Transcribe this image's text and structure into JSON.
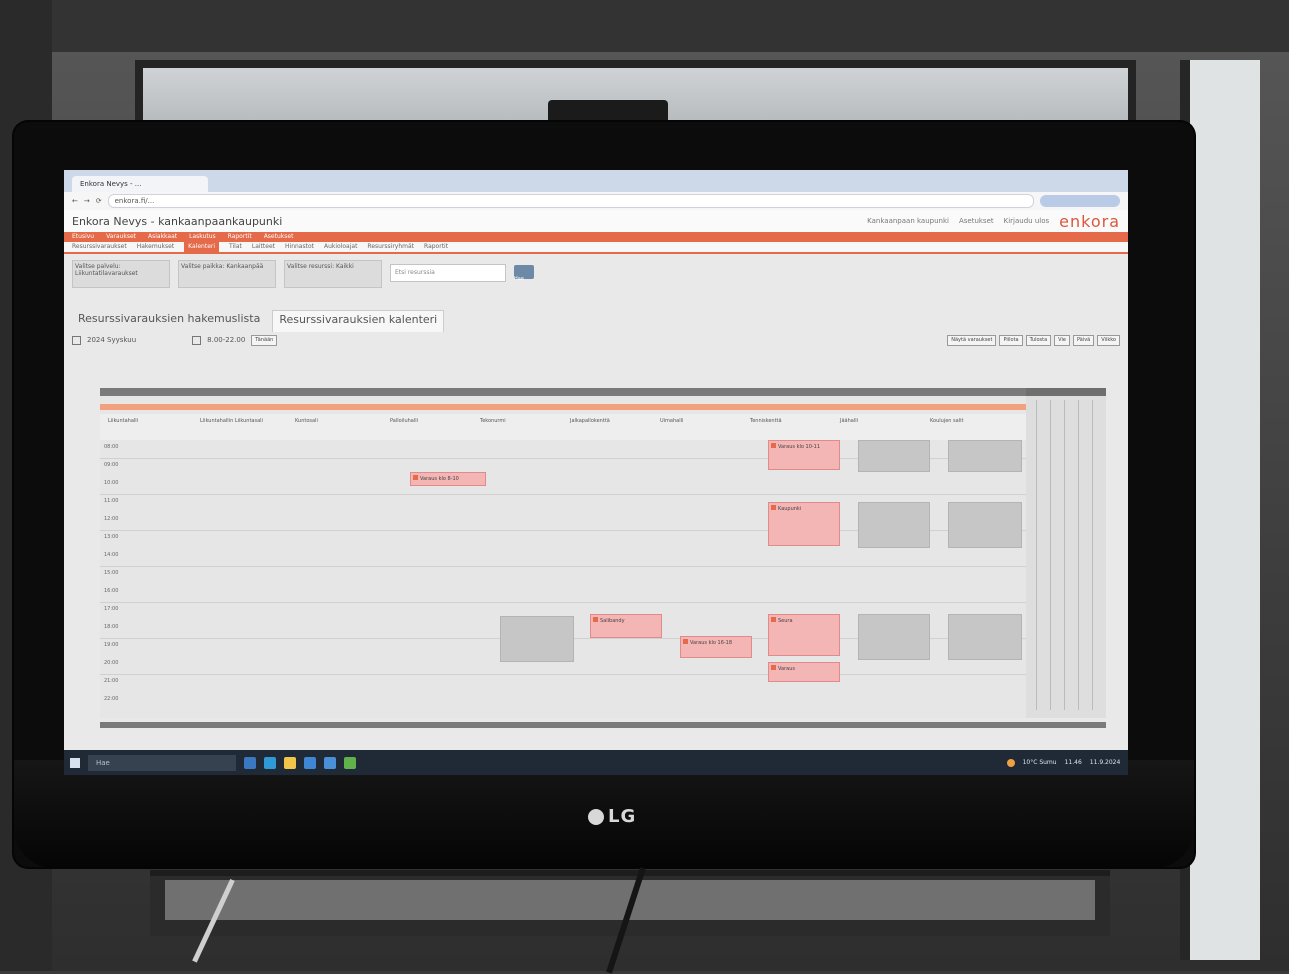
{
  "tv_logo": "LG",
  "browser": {
    "tab_title": "Enkora Nevys - ...",
    "url": "enkora.fi/..."
  },
  "app": {
    "title": "Enkora Nevys - kankaanpaankaupunki",
    "brand": "enkora",
    "user_menu": [
      "Kankaanpaan kaupunki",
      "Asetukset",
      "Kirjaudu ulos"
    ]
  },
  "nav_main": [
    "Etusivu",
    "Varaukset",
    "Asiakkaat",
    "Laskutus",
    "Raportit",
    "Asetukset"
  ],
  "nav_sub": [
    "Resurssivaraukset",
    "Hakemukset",
    "Kalenteri",
    "Tilat",
    "Laitteet",
    "Hinnastot",
    "Aukioloajat",
    "Resurssiryhmät",
    "Raportit"
  ],
  "filters": {
    "box1": "Valitse palvelu: Liikuntatilavaraukset",
    "box2": "Valitse paikka: Kankaanpää",
    "box3": "Valitse resurssi: Kaikki",
    "search_placeholder": "Etsi resurssia",
    "search_button": "Hae"
  },
  "tabs": [
    "Resurssivarauksien hakemuslista",
    "Resurssivarauksien kalenteri"
  ],
  "toolbar": {
    "date": "2024 Syyskuu",
    "time_range": "8.00-22.00",
    "today_button": "Tänään",
    "right_buttons": [
      "Näytä varaukset",
      "Piilota",
      "Tulosta",
      "Vie",
      "Päivä",
      "Viikko"
    ]
  },
  "grid_columns": [
    "Liikuntahalli",
    "Liikuntahallin Liikuntasali",
    "Kuntosali",
    "Palloiluhalli",
    "Tekonurmi",
    "Jalkapallokenttä",
    "Uimahalli",
    "Tenniskenttä",
    "Jäähalli",
    "Koulujen salit"
  ],
  "time_labels": [
    "08:00",
    "09:00",
    "10:00",
    "11:00",
    "12:00",
    "13:00",
    "14:00",
    "15:00",
    "16:00",
    "17:00",
    "18:00",
    "19:00",
    "20:00",
    "21:00",
    "22:00"
  ],
  "events": [
    {
      "text": "Varaus klo 8-10"
    },
    {
      "text": "Varaus klo 10-11"
    },
    {
      "text": "Kaupunki"
    },
    {
      "text": "Salibandy"
    },
    {
      "text": "Varaus klo 16-18"
    },
    {
      "text": "Seura"
    },
    {
      "text": "Varaus"
    }
  ],
  "taskbar": {
    "search": "Hae",
    "weather": "10°C Sumu",
    "time": "11.46",
    "date": "11.9.2024"
  },
  "colors": {
    "accent": "#e46a4a",
    "event_fill": "#f4b5b5",
    "taskbar": "#1f2a36"
  }
}
